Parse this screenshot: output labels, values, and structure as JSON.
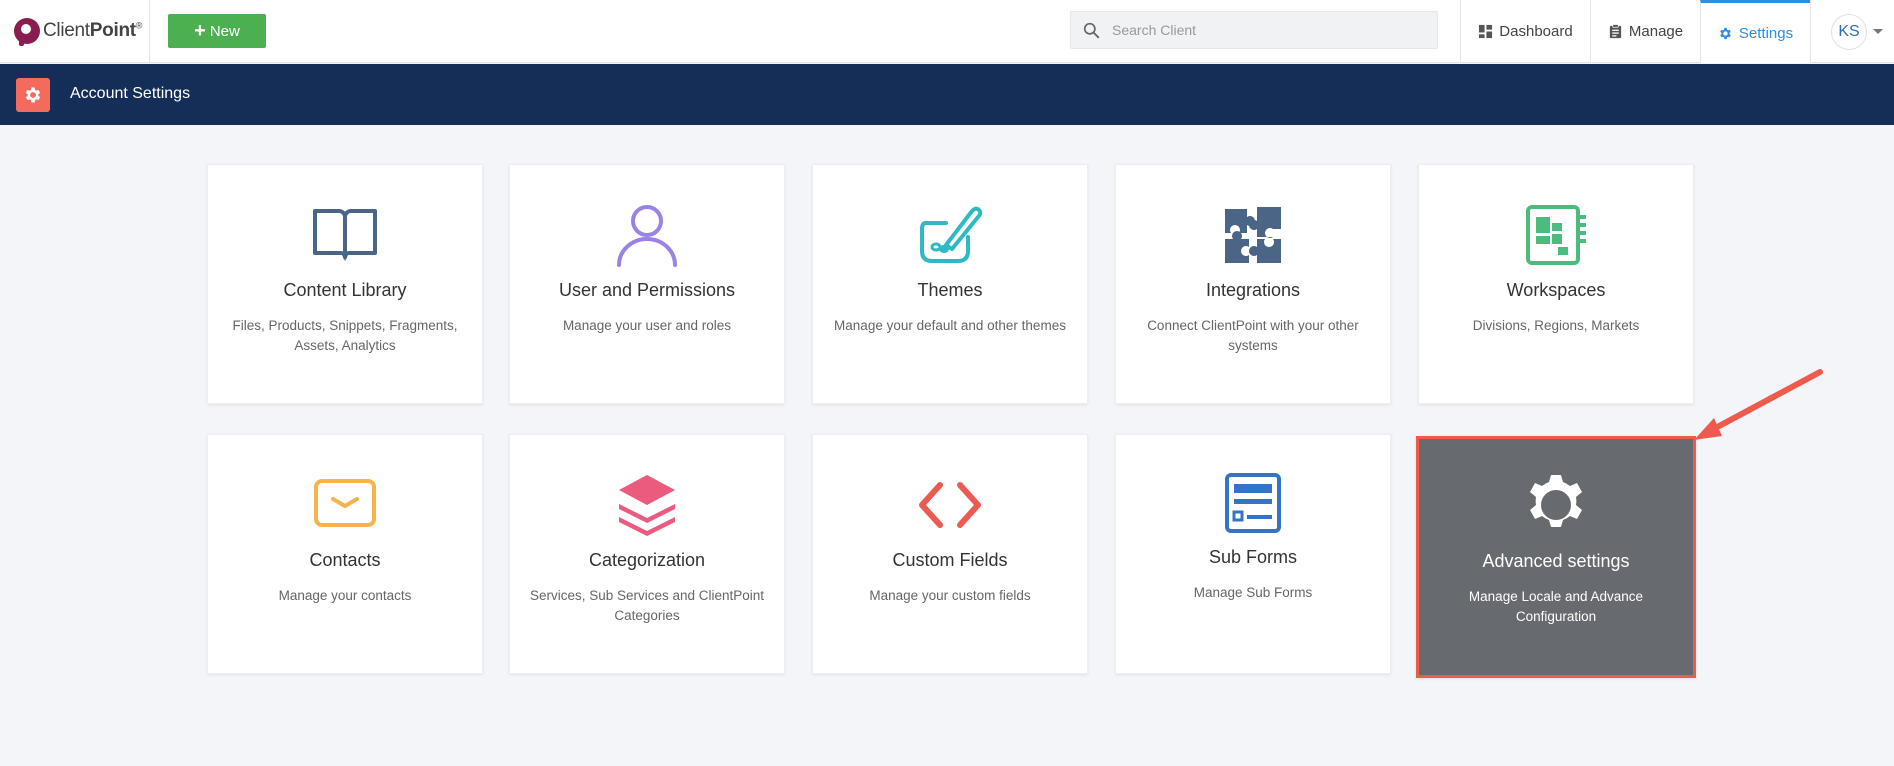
{
  "topbar": {
    "logo_text_light": "Client",
    "logo_text_bold": "Point",
    "logo_reg": "®",
    "new_label": "New",
    "search_placeholder": "Search Client",
    "nav": {
      "dashboard": "Dashboard",
      "manage": "Manage",
      "settings": "Settings"
    },
    "user_initials": "KS"
  },
  "header": {
    "title": "Account Settings"
  },
  "cards": [
    {
      "title": "Content Library",
      "desc": "Files, Products, Snippets, Fragments, Assets, Analytics",
      "icon": "book-icon",
      "color": "#4a6585"
    },
    {
      "title": "User and Permissions",
      "desc": "Manage your user and roles",
      "icon": "user-icon",
      "color": "#9b83e6"
    },
    {
      "title": "Themes",
      "desc": "Manage your default and other themes",
      "icon": "palette-icon",
      "color": "#2fb9c4"
    },
    {
      "title": "Integrations",
      "desc": "Connect ClientPoint with your other systems",
      "icon": "puzzle-icon",
      "color": "#4a6585"
    },
    {
      "title": "Workspaces",
      "desc": "Divisions, Regions, Markets",
      "icon": "workspace-icon",
      "color": "#4cbc7c"
    },
    {
      "title": "Contacts",
      "desc": "Manage your contacts",
      "icon": "envelope-icon",
      "color": "#f7b24a"
    },
    {
      "title": "Categorization",
      "desc": "Services, Sub Services and ClientPoint Categories",
      "icon": "layers-icon",
      "color": "#ea5b7e"
    },
    {
      "title": "Custom Fields",
      "desc": "Manage your custom fields",
      "icon": "code-icon",
      "color": "#ec5b52"
    },
    {
      "title": "Sub Forms",
      "desc": "Manage Sub Forms",
      "icon": "form-icon",
      "color": "#3474c6"
    },
    {
      "title": "Advanced settings",
      "desc": "Manage Locale and Advance Configuration",
      "icon": "gear-icon",
      "color": "#ffffff"
    }
  ],
  "colors": {
    "header_bg": "#152e57",
    "accent": "#2d8fe0",
    "new_button": "#4caf50",
    "highlight_border": "#ee5a4c",
    "arrow": "#ee5a4c"
  }
}
